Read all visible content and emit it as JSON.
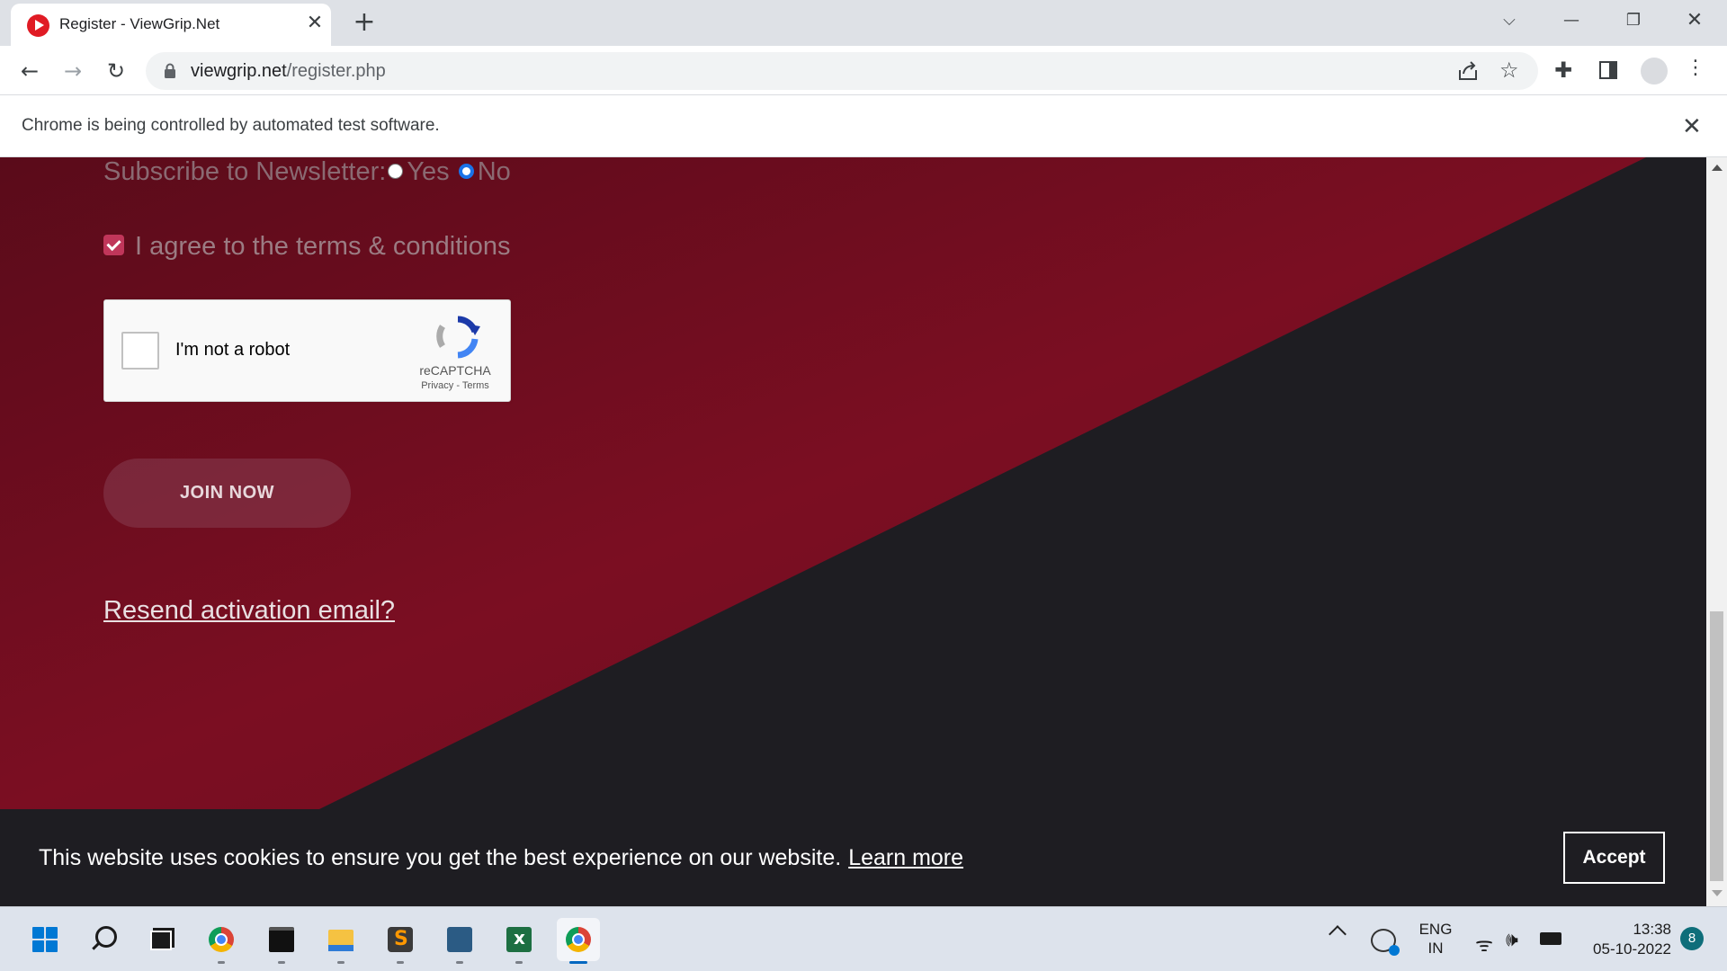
{
  "browser": {
    "tab_title": "Register - ViewGrip.Net",
    "tab_close": "✕",
    "new_tab": "+",
    "url_host": "viewgrip.net",
    "url_path": "/register.php",
    "infobar_text": "Chrome is being controlled by automated test software.",
    "infobar_close": "✕"
  },
  "form": {
    "newsletter_label": "Subscribe to Newsletter:",
    "newsletter_options": [
      "Yes",
      "No"
    ],
    "newsletter_selected": "No",
    "terms_label": "I agree to the terms & conditions",
    "terms_checked": true,
    "recaptcha": {
      "label": "I'm not a robot",
      "brand": "reCAPTCHA",
      "links": "Privacy - Terms"
    },
    "join_button": "JOIN NOW",
    "resend_link": "Resend activation email?"
  },
  "cookie_banner": {
    "text": "This website uses cookies to ensure you get the best experience on our website.",
    "learn_more": "Learn more",
    "accept": "Accept"
  },
  "taskbar": {
    "apps": [
      "start",
      "search",
      "task-view",
      "chrome",
      "terminal",
      "file-explorer",
      "sublime-text",
      "mysql-workbench",
      "excel",
      "chrome-active"
    ],
    "tray_lang": [
      "ENG",
      "IN"
    ],
    "time": "13:38",
    "date": "05-10-2022",
    "notification_count": "8"
  },
  "colors": {
    "page_red": "#7a0f22",
    "page_dark": "#1e1d22",
    "checkbox": "#c0365a",
    "accent_blue": "#1a73e8"
  }
}
